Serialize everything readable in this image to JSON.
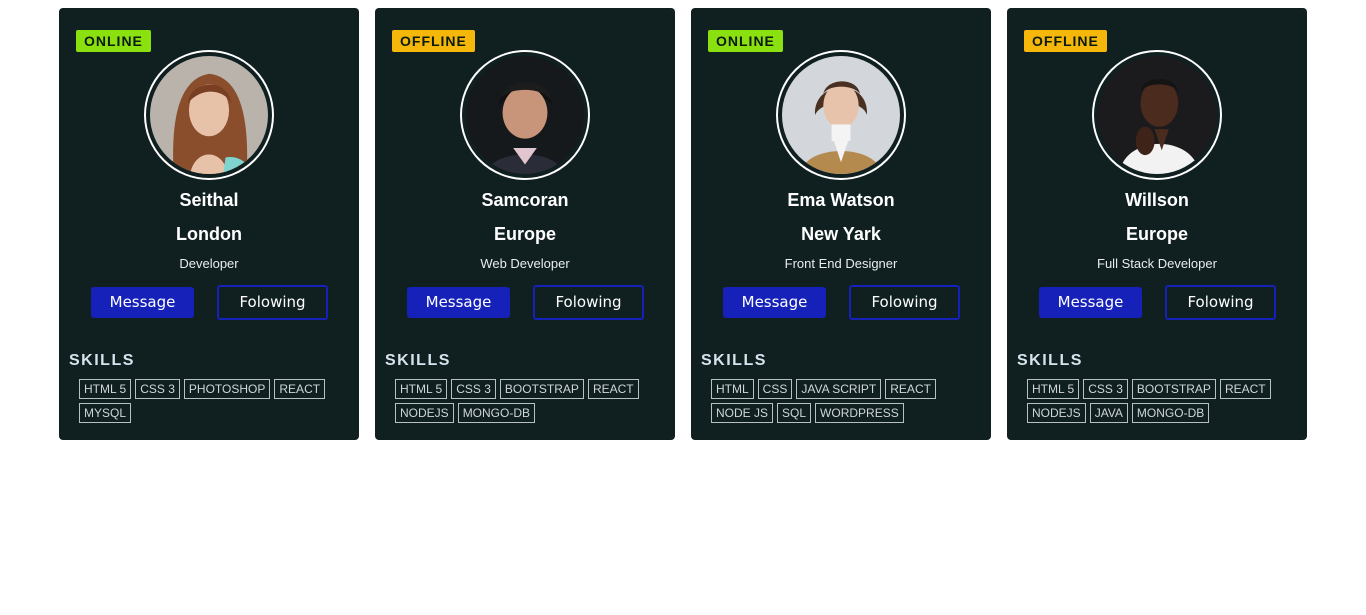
{
  "colors": {
    "card_bg": "#101f20",
    "online": "#8be00f",
    "offline": "#f5b70a",
    "primary_button": "#1521b8"
  },
  "cards": [
    {
      "status": "ONLINE",
      "status_color": "#8be00f",
      "name": "Seithal",
      "location": "London",
      "role": "Developer",
      "message_label": "Message",
      "following_label": "Folowing",
      "skills_title": "SKILLS",
      "skills": [
        "HTML 5",
        "CSS 3",
        "PHOTOSHOP",
        "REACT",
        "MYSQL"
      ]
    },
    {
      "status": "OFFLINE",
      "status_color": "#f5b70a",
      "name": "Samcoran",
      "location": "Europe",
      "role": "Web Developer",
      "message_label": "Message",
      "following_label": "Folowing",
      "skills_title": "SKILLS",
      "skills": [
        "HTML 5",
        "CSS 3",
        "BOOTSTRAP",
        "REACT",
        "NODEJS",
        "MONGO-DB"
      ]
    },
    {
      "status": "ONLINE",
      "status_color": "#8be00f",
      "name": "Ema Watson",
      "location": "New Yark",
      "role": "Front End Designer",
      "message_label": "Message",
      "following_label": "Folowing",
      "skills_title": "SKILLS",
      "skills": [
        "HTML",
        "CSS",
        "JAVA SCRIPT",
        "REACT",
        "NODE JS",
        "SQL",
        "WORDPRESS"
      ]
    },
    {
      "status": "OFFLINE",
      "status_color": "#f5b70a",
      "name": "Willson",
      "location": "Europe",
      "role": "Full Stack Developer",
      "message_label": "Message",
      "following_label": "Folowing",
      "skills_title": "SKILLS",
      "skills": [
        "HTML 5",
        "CSS 3",
        "BOOTSTRAP",
        "REACT",
        "NODEJS",
        "JAVA",
        "MONGO-DB"
      ]
    }
  ]
}
